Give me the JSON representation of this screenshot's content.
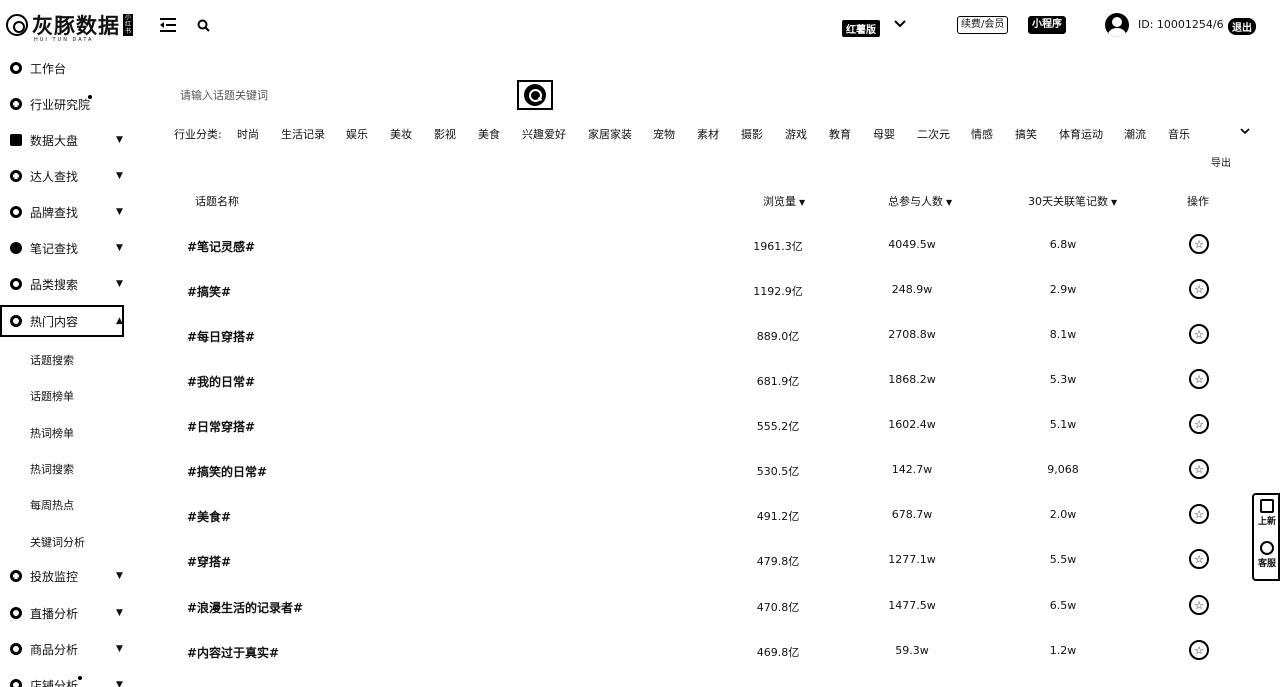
{
  "header": {
    "logo_text": "灰豚数据",
    "logo_sub": "HUI TUN DATA",
    "logo_tag": "小红书",
    "version": "红薯版",
    "member_button": "续费/会员",
    "mini_program_button": "小程序",
    "user_id": "ID: 10001254/6",
    "logout": "退出"
  },
  "sidebar": {
    "items": [
      {
        "label": "工作台",
        "icon": "dashboard-icon"
      },
      {
        "label": "行业研究院",
        "icon": "research-icon"
      },
      {
        "label": "数据大盘",
        "icon": "data-panel-icon"
      },
      {
        "label": "达人查找",
        "icon": "influencer-icon"
      },
      {
        "label": "品牌查找",
        "icon": "brand-icon"
      },
      {
        "label": "笔记查找",
        "icon": "note-icon"
      },
      {
        "label": "品类搜索",
        "icon": "category-icon"
      },
      {
        "label": "热门内容",
        "icon": "hot-content-icon"
      }
    ],
    "sub_items": [
      "话题搜索",
      "话题榜单",
      "热词榜单",
      "热词搜索",
      "每周热点",
      "关键词分析"
    ],
    "bottom_items": [
      {
        "label": "投放监控",
        "icon": "monitor-icon"
      },
      {
        "label": "直播分析",
        "icon": "live-icon"
      },
      {
        "label": "商品分析",
        "icon": "product-icon"
      },
      {
        "label": "店铺分析",
        "icon": "shop-icon"
      }
    ]
  },
  "search": {
    "placeholder": "请输入话题关键词"
  },
  "categories": {
    "label": "行业分类:",
    "items": [
      "时尚",
      "生活记录",
      "娱乐",
      "美妆",
      "影视",
      "美食",
      "兴趣爱好",
      "家居家装",
      "宠物",
      "素材",
      "摄影",
      "游戏",
      "教育",
      "母婴",
      "二次元",
      "情感",
      "搞笑",
      "体育运动",
      "潮流",
      "音乐"
    ]
  },
  "export_label": "导出",
  "table": {
    "headers": {
      "name": "话题名称",
      "views": "浏览量",
      "people": "总参与人数",
      "notes": "30天关联笔记数",
      "action": "操作"
    },
    "rows": [
      {
        "topic": "#笔记灵感#",
        "views": "1961.3亿",
        "people": "4049.5w",
        "notes": "6.8w"
      },
      {
        "topic": "#搞笑#",
        "views": "1192.9亿",
        "people": "248.9w",
        "notes": "2.9w"
      },
      {
        "topic": "#每日穿搭#",
        "views": "889.0亿",
        "people": "2708.8w",
        "notes": "8.1w"
      },
      {
        "topic": "#我的日常#",
        "views": "681.9亿",
        "people": "1868.2w",
        "notes": "5.3w"
      },
      {
        "topic": "#日常穿搭#",
        "views": "555.2亿",
        "people": "1602.4w",
        "notes": "5.1w"
      },
      {
        "topic": "#搞笑的日常#",
        "views": "530.5亿",
        "people": "142.7w",
        "notes": "9,068"
      },
      {
        "topic": "#美食#",
        "views": "491.2亿",
        "people": "678.7w",
        "notes": "2.0w"
      },
      {
        "topic": "#穿搭#",
        "views": "479.8亿",
        "people": "1277.1w",
        "notes": "5.5w"
      },
      {
        "topic": "#浪漫生活的记录者#",
        "views": "470.8亿",
        "people": "1477.5w",
        "notes": "6.5w"
      },
      {
        "topic": "#内容过于真实#",
        "views": "469.8亿",
        "people": "59.3w",
        "notes": "1.2w"
      }
    ]
  },
  "float": {
    "top": "上新",
    "bottom": "客服"
  }
}
